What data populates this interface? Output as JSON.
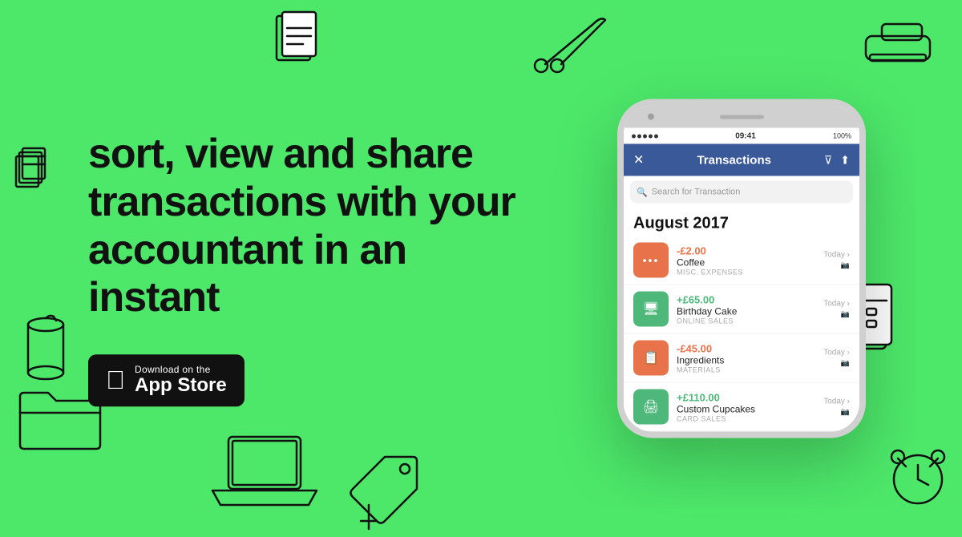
{
  "background": {
    "color": "#4de86a"
  },
  "headline": {
    "line1": "sort, view and share",
    "line2": "transactions with your",
    "line3": "accountant in an instant"
  },
  "app_store_button": {
    "top_text": "Download on the",
    "bottom_text": "App Store"
  },
  "phone": {
    "status_bar": {
      "dots": 5,
      "time": "09:41",
      "battery": "100%"
    },
    "nav": {
      "title": "Transactions"
    },
    "search": {
      "placeholder": "Search for Transaction"
    },
    "month": "August 2017",
    "transactions": [
      {
        "id": 1,
        "icon_type": "orange",
        "icon_symbol": "•••",
        "amount": "-£2.00",
        "amount_type": "negative",
        "name": "Coffee",
        "category": "MISC. EXPENSES",
        "date": "Today"
      },
      {
        "id": 2,
        "icon_type": "green",
        "icon_symbol": "🖥",
        "amount": "+£65.00",
        "amount_type": "positive",
        "name": "Birthday Cake",
        "category": "ONLINE SALES",
        "date": "Today"
      },
      {
        "id": 3,
        "icon_type": "orange",
        "icon_symbol": "📋",
        "amount": "-£45.00",
        "amount_type": "negative",
        "name": "Ingredients",
        "category": "MATERIALS",
        "date": "Today"
      },
      {
        "id": 4,
        "icon_type": "green",
        "icon_symbol": "🖨",
        "amount": "+£110.00",
        "amount_type": "positive",
        "name": "Custom Cupcakes",
        "category": "CARD SALES",
        "date": "Today"
      }
    ]
  }
}
